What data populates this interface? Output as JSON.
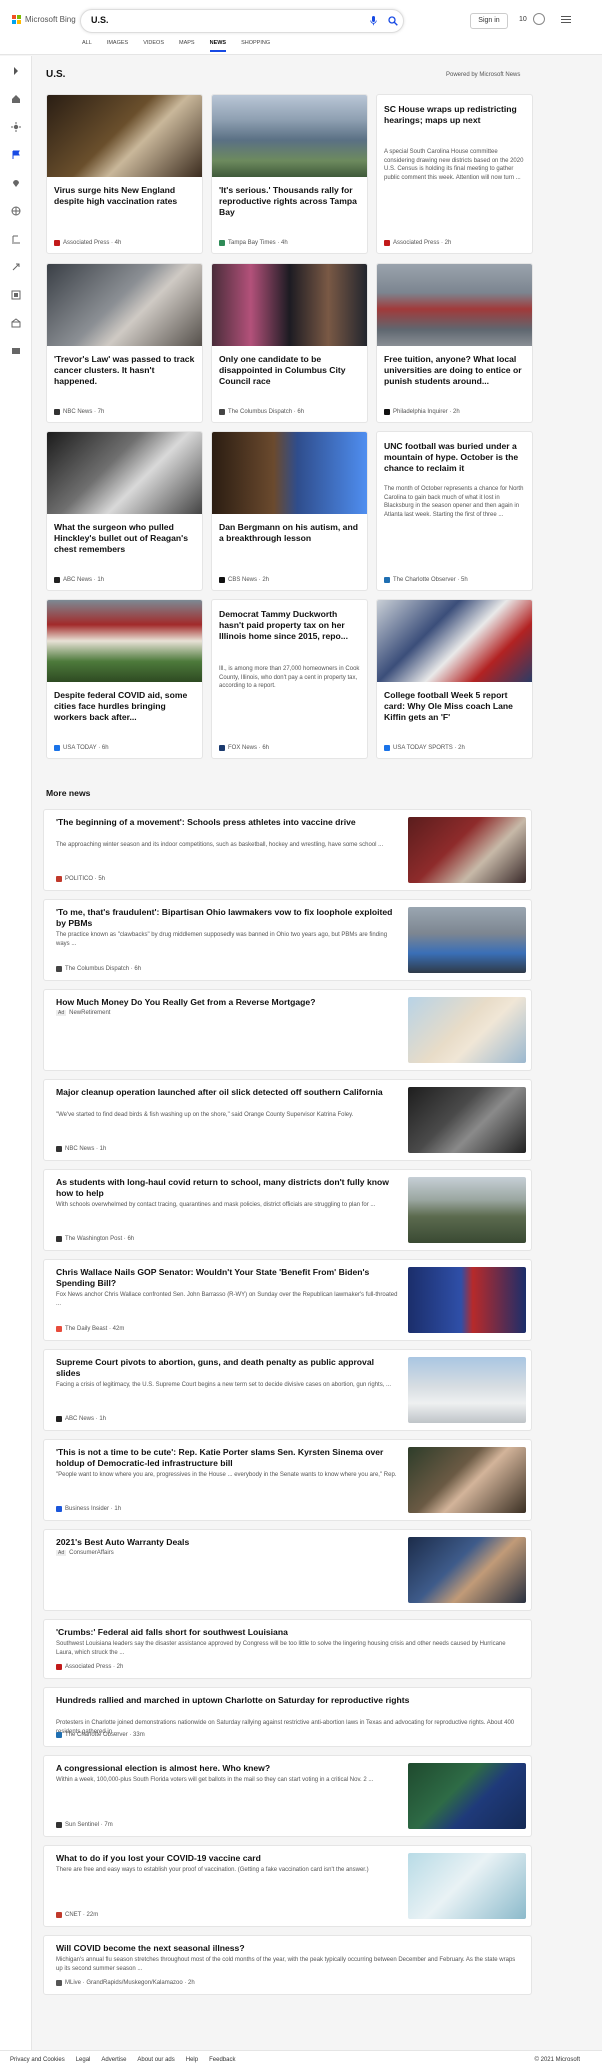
{
  "header": {
    "brand": "Microsoft Bing",
    "search_value": "U.S.",
    "signin_label": "Sign in",
    "rewards_count": "10"
  },
  "tabs": [
    {
      "label": "ALL"
    },
    {
      "label": "IMAGES"
    },
    {
      "label": "VIDEOS"
    },
    {
      "label": "MAPS"
    },
    {
      "label": "NEWS",
      "active": true
    },
    {
      "label": "SHOPPING"
    }
  ],
  "section_title": "U.S.",
  "powered": "Powered by Microsoft News",
  "cards": [
    {
      "title": "Virus surge hits New England despite high vaccination rates",
      "source": "Associated Press · 4h",
      "logo": "#c21a1a",
      "img": "linear-gradient(135deg,#2a1e14,#6a4f2c 45%,#c9b79a 60%,#3b2c1f)"
    },
    {
      "title": "'It's serious.' Thousands rally for reproductive rights across Tampa Bay",
      "source": "Tampa Bay Times · 4h",
      "logo": "#2e8b57",
      "img": "linear-gradient(180deg,#b9c6d6 0%,#8fa0b2 30%,#5a7084 55%,#6d8a5e 80%,#3f5a3a 100%)"
    },
    {
      "title": "SC House wraps up redistricting hearings; maps up next",
      "desc": "A special South Carolina House committee considering drawing new districts based on the 2020 U.S. Census is holding its final meeting to gather public comment this week. Attention will now turn ...",
      "source": "Associated Press · 2h",
      "logo": "#c21a1a"
    },
    {
      "title": "'Trevor's Law' was passed to track cancer clusters. It hasn't happened.",
      "source": "NBC News · 7h",
      "logo": "#333",
      "img": "linear-gradient(135deg,#3a3f46,#8b8f94 45%,#cfcac4 60%,#55504b)"
    },
    {
      "title": "Only one candidate to be disappointed in Columbus City Council race",
      "source": "The Columbus Dispatch · 6h",
      "logo": "#444",
      "img": "linear-gradient(90deg,#4a2d3a,#b3517a 25%,#1c1b22 50%,#7a5945 75%,#23262e)"
    },
    {
      "title": "Free tuition, anyone? What local universities are doing to entice or punish students around...",
      "source": "Philadelphia Inquirer · 2h",
      "logo": "#111",
      "img": "linear-gradient(180deg,#9aa3ad,#7c8590 35%,#a13a3a 55%,#5f6770 80%,#8a8f95)"
    },
    {
      "title": "What the surgeon who pulled Hinckley's bullet out of Reagan's chest remembers",
      "source": "ABC News · 1h",
      "logo": "#222",
      "img": "linear-gradient(135deg,#1c1c1c,#6f6f6f 40%,#d9d9d9 60%,#444)"
    },
    {
      "title": "Dan Bergmann on his autism, and a breakthrough lesson",
      "source": "CBS News · 2h",
      "logo": "#111",
      "img": "linear-gradient(90deg,#2b1d12,#6b4a2e 40%,#2f4d8c 55%,#4f8ef0 100%)"
    },
    {
      "title": "UNC football was buried under a mountain of hype. October is the chance to reclaim it",
      "desc": "The month of October represents a chance for North Carolina to gain back much of what it lost in Blacksburg in the season opener and then again in Atlanta last week. Starting the first of three ...",
      "source": "The Charlotte Observer · 5h",
      "logo": "#1f6fb2"
    },
    {
      "title": "Despite federal COVID aid, some cities face hurdles bringing workers back after...",
      "source": "USA TODAY · 6h",
      "logo": "#1a73e8",
      "img": "linear-gradient(180deg,#7c8a94 0%,#a22a2a 30%,#e8e2d6 50%,#4d7a3b 75%,#2e4a22 100%)"
    },
    {
      "title": "Democrat Tammy Duckworth hasn't paid property tax on her Illinois home since 2015, repo...",
      "desc": "Ill., is among more than 27,000 homeowners in Cook County, Illinois, who don't pay a cent in property tax, according to a report.",
      "source": "FOX News · 6h",
      "logo": "#1a3a6e"
    },
    {
      "title": "College football Week 5 report card: Why Ole Miss coach Lane Kiffin gets an 'F'",
      "source": "USA TODAY SPORTS · 2h",
      "logo": "#1a73e8",
      "img": "linear-gradient(135deg,#c9cfd6,#3b4e7a 35%,#e9e9e9 55%,#b22222 75%,#2b3c66)"
    }
  ],
  "more_news_title": "More news",
  "more_news": [
    {
      "title": "'The beginning of a movement': Schools press athletes into vaccine drive",
      "desc": "The approaching winter season and its indoor competitions, such as basketball, hockey and wrestling, have some school ...",
      "source": "POLITICO · 5h",
      "logo": "#c0392b",
      "thumb": "linear-gradient(135deg,#5a1d1d,#8e2b2b 40%,#c7b9a8 65%,#3a2a2a)"
    },
    {
      "title": "'To me, that's fraudulent': Bipartisan Ohio lawmakers vow to fix loophole exploited by PBMs",
      "desc": "The practice known as \"clawbacks\" by drug middlemen supposedly was banned in Ohio two years ago, but PBMs are finding ways ...",
      "source": "The Columbus Dispatch · 6h",
      "logo": "#444",
      "thumb": "linear-gradient(180deg,#9aa6b1,#7d8691 40%,#3a6fb7 70%,#2f3a48)"
    },
    {
      "title": "How Much Money Do You Really Get from a Reverse Mortgage?",
      "ad": "Ad",
      "source": "NewRetirement",
      "logo": "",
      "thumb": "linear-gradient(135deg,#b8d3e6,#e8dcc8 45%,#f0e6d6 60%,#9bb8cf)"
    },
    {
      "title": "Major cleanup operation launched after oil slick detected off southern California",
      "desc": "\"We've started to find dead birds & fish washing up on the shore,\" said Orange County Supervisor Katrina Foley.",
      "source": "NBC News · 1h",
      "logo": "#333",
      "thumb": "linear-gradient(135deg,#1e1e1e,#4a4a4a 40%,#8a8a8a 60%,#222)"
    },
    {
      "title": "As students with long-haul covid return to school, many districts don't fully know how to help",
      "desc": "With schools overwhelmed by contact tracing, quarantines and mask policies, district officials are struggling to plan for ...",
      "source": "The Washington Post · 6h",
      "logo": "#333",
      "thumb": "linear-gradient(180deg,#c6cfd6,#9aa6a0 35%,#5b6a4e 60%,#3a4a33)"
    },
    {
      "title": "Chris Wallace Nails GOP Senator: Wouldn't Your State 'Benefit From' Biden's Spending Bill?",
      "desc": "Fox News anchor Chris Wallace confronted Sen. John Barrasso (R-WY) on Sunday over the Republican lawmaker's full-throated ...",
      "source": "The Daily Beast · 42m",
      "logo": "#e74c3c",
      "thumb": "linear-gradient(90deg,#1b2e6b,#2f4fa8 45%,#b72a2a 55%,#1b2e6b)"
    },
    {
      "title": "Supreme Court pivots to abortion, guns, and death penalty as public approval slides",
      "desc": "Facing a crisis of legitimacy, the U.S. Supreme Court begins a new term set to decide divisive cases on abortion, gun rights, ...",
      "source": "ABC News · 1h",
      "logo": "#222",
      "thumb": "linear-gradient(180deg,#a9c6e2,#d7dde2 45%,#eef0f1 70%,#bfc4c8)"
    },
    {
      "title": "'This is not a time to be cute': Rep. Katie Porter slams Sen. Kyrsten Sinema over holdup of Democratic-led infrastructure bill",
      "desc": "\"People want to know where you are, progressives in the House ... everybody in the Senate wants to know where you are,\" Rep.",
      "source": "Business Insider · 1h",
      "logo": "#1a56db",
      "thumb": "linear-gradient(135deg,#2e3d2a,#6b5a44 40%,#d3b49a 55%,#3b3024)"
    },
    {
      "title": "2021's Best Auto Warranty Deals",
      "ad": "Ad",
      "source": "ConsumerAffairs",
      "logo": "",
      "thumb": "linear-gradient(135deg,#1c2c4a,#3e5b8a 40%,#c19b78 60%,#2a3140)"
    },
    {
      "title": "'Crumbs:' Federal aid falls short for southwest Louisiana",
      "desc": "Southwest Louisiana leaders say the disaster assistance approved by Congress will be too little to solve the lingering housing crisis and other needs caused by Hurricane Laura, which struck the ...",
      "source": "Associated Press · 2h",
      "logo": "#c21a1a",
      "nothumb": true
    },
    {
      "title": "Hundreds rallied and marched in uptown Charlotte on Saturday for reproductive rights",
      "desc": "Protesters in Charlotte joined demonstrations nationwide on Saturday rallying against restrictive anti-abortion laws in Texas and advocating for reproductive rights. About 400 residents gathered in ...",
      "source": "The Charlotte Observer · 33m",
      "logo": "#1f6fb2",
      "nothumb": true
    },
    {
      "title": "A congressional election is almost here. Who knew?",
      "desc": "Within a week, 100,000-plus South Florida voters will get ballots in the mail so they can start voting in a critical Nov. 2 ...",
      "source": "Sun Sentinel · 7m",
      "logo": "#333",
      "thumb": "linear-gradient(135deg,#1f4a2e,#2e6b46 40%,#1f3a7a 60%,#152a55)"
    },
    {
      "title": "What to do if you lost your COVID-19 vaccine card",
      "desc": "There are free and easy ways to establish your proof of vaccination. (Getting a fake vaccination card isn't the answer.)",
      "source": "CNET · 22m",
      "logo": "#c0392b",
      "thumb": "linear-gradient(135deg,#b8dbe6,#e9f2f5 45%,#cfe3ea 60%,#8cbacb)"
    },
    {
      "title": "Will COVID become the next seasonal illness?",
      "desc": "Michigan's annual flu season stretches throughout most of the cold months of the year, with the peak typically occurring between December and February. As the state wraps up its second summer season ...",
      "source": "MLive · GrandRapids/Muskegon/Kalamazoo · 2h",
      "logo": "#555",
      "nothumb": true
    }
  ],
  "footer": {
    "links": [
      "Privacy and Cookies",
      "Legal",
      "Advertise",
      "About our ads",
      "Help",
      "Feedback"
    ],
    "copyright": "© 2021 Microsoft"
  }
}
